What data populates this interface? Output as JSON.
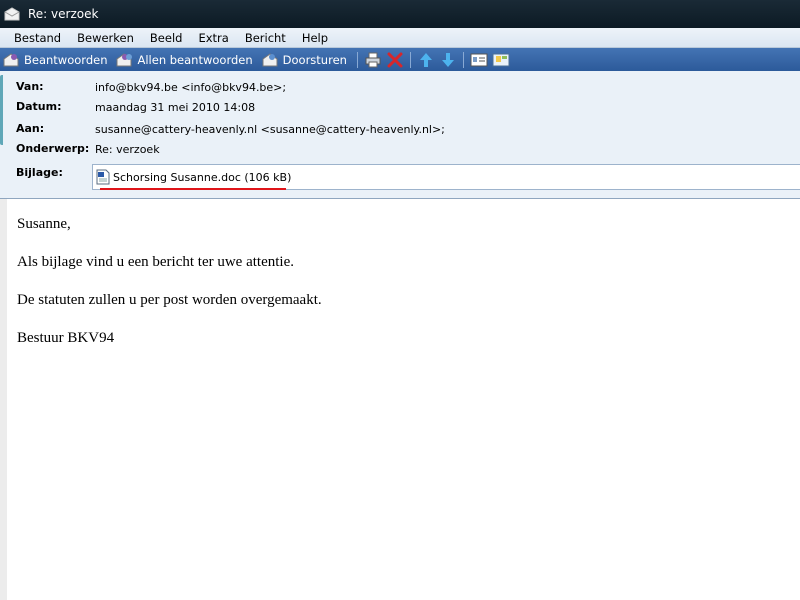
{
  "window": {
    "title": "Re: verzoek"
  },
  "menu": {
    "items": [
      "Bestand",
      "Bewerken",
      "Beeld",
      "Extra",
      "Bericht",
      "Help"
    ]
  },
  "toolbar": {
    "reply_label": "Beantwoorden",
    "reply_all_label": "Allen beantwoorden",
    "forward_label": "Doorsturen",
    "icons": [
      "print-icon",
      "delete-icon",
      "previous-icon",
      "next-icon",
      "contacts-icon",
      "addresses-icon"
    ]
  },
  "header": {
    "from_label": "Van:",
    "from_value": "info@bkv94.be <info@bkv94.be>;",
    "date_label": "Datum:",
    "date_value": "maandag 31 mei 2010 14:08",
    "to_label": "Aan:",
    "to_value": "susanne@cattery-heavenly.nl <susanne@cattery-heavenly.nl>;",
    "subject_label": "Onderwerp:",
    "subject_value": "Re: verzoek",
    "attachment_label": "Bijlage:",
    "attachment_value": "Schorsing Susanne.doc (106 kB)"
  },
  "body": {
    "paragraphs": [
      "Susanne,",
      "Als bijlage vind u een bericht ter uwe attentie.",
      "De statuten zullen u per post worden overgemaakt.",
      "Bestuur BKV94"
    ]
  },
  "colors": {
    "toolbar": "#3a67a8",
    "header_bg": "#eaf1f8",
    "highlight_underline": "#e0151a"
  }
}
